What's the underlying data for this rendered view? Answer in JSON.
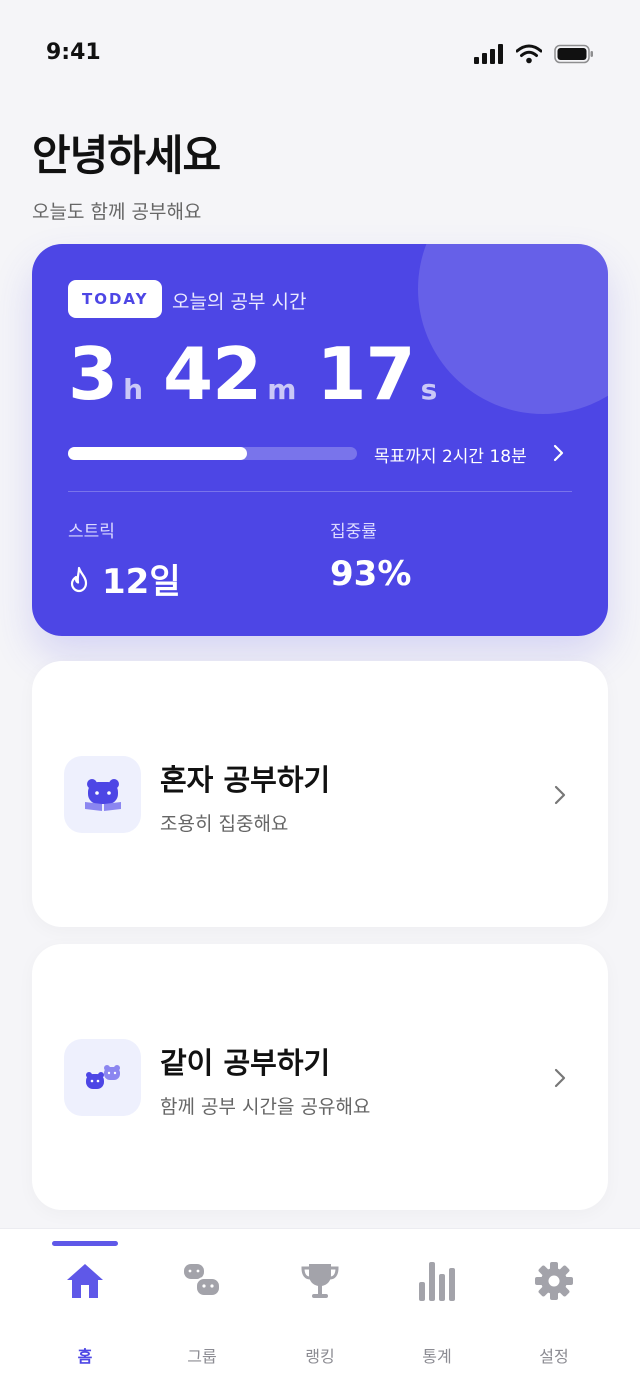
{
  "status_bar": {
    "time": "9:41"
  },
  "greeting": {
    "title": "안녕하세요",
    "subtitle": "오늘도 함께 공부해요"
  },
  "today_card": {
    "badge": "TODAY",
    "label": "오늘의 공부 시간",
    "hours": "3",
    "hours_unit": "h",
    "minutes": "42",
    "minutes_unit": "m",
    "seconds": "17",
    "seconds_unit": "s",
    "progress_fraction": 0.62,
    "goal_text": "목표까지 2시간 18분",
    "streak_label": "스트릭",
    "streak_value": "12일",
    "focus_label": "집중률",
    "focus_value": "93%"
  },
  "actions": [
    {
      "title": "혼자 공부하기",
      "subtitle": "조용히 집중해요"
    },
    {
      "title": "같이 공부하기",
      "subtitle": "함께 공부 시간을 공유해요"
    }
  ],
  "tabs": [
    {
      "label": "홈",
      "icon": "home-icon",
      "active": true
    },
    {
      "label": "그룹",
      "icon": "group-icon"
    },
    {
      "label": "랭킹",
      "icon": "trophy-icon"
    },
    {
      "label": "통계",
      "icon": "bar-chart-icon"
    },
    {
      "label": "설정",
      "icon": "gear-icon"
    }
  ],
  "colors": {
    "accent": "#4d46e5",
    "inactive": "#a3a3aa",
    "background": "#f5f5f8"
  }
}
